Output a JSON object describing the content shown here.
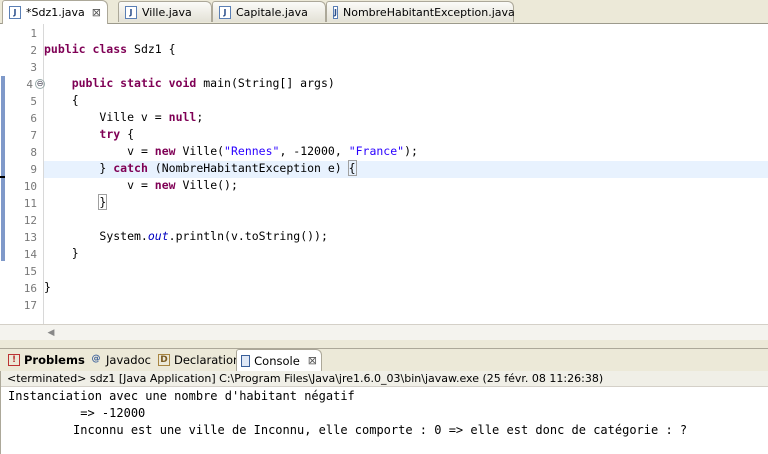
{
  "editor_tabs": [
    {
      "label": "*Sdz1.java",
      "close": "⊠"
    },
    {
      "label": "Ville.java"
    },
    {
      "label": "Capitale.java"
    },
    {
      "label": "NombreHabitantException.java"
    }
  ],
  "line_numbers": [
    "1",
    "2",
    "3",
    "4",
    "5",
    "6",
    "7",
    "8",
    "9",
    "10",
    "11",
    "12",
    "13",
    "14",
    "15",
    "16",
    "17"
  ],
  "code": {
    "l2_kw": "public class",
    "l2_rest": " Sdz1 {",
    "l4_kw": "public static void",
    "l4_rest": " main(String[] args)",
    "l5": "{",
    "l6_a": "Ville v = ",
    "l6_kw": "null",
    "l6_b": ";",
    "l7_kw": "try",
    "l7_rest": " {",
    "l8_a": "v = ",
    "l8_kw": "new",
    "l8_b": " Ville(",
    "l8_s1": "\"Rennes\"",
    "l8_c": ", -12000, ",
    "l8_s2": "\"France\"",
    "l8_d": ");",
    "l9_a": "} ",
    "l9_kw": "catch",
    "l9_b": " (NombreHabitantException e) ",
    "l9_brace": "{",
    "l10_a": "v = ",
    "l10_kw": "new",
    "l10_b": " Ville();",
    "l11": "}",
    "l13_a": "System.",
    "l13_static": "out",
    "l13_b": ".println(v.toString());",
    "l14": "}",
    "l16": "}"
  },
  "fold_marker": "⊖",
  "views": {
    "problems": "Problems",
    "javadoc": "Javadoc",
    "declaration": "Declaration",
    "console": "Console",
    "console_close": "⊠"
  },
  "console": {
    "status": "<terminated> sdz1 [Java Application] C:\\Program Files\\Java\\jre1.6.0_03\\bin\\javaw.exe (25 févr. 08 11:26:38)",
    "lines": [
      "Instanciation avec une nombre d'habitant négatif",
      "          => -12000",
      "         Inconnu est une ville de Inconnu, elle comporte : 0 => elle est donc de catégorie : ?"
    ]
  }
}
